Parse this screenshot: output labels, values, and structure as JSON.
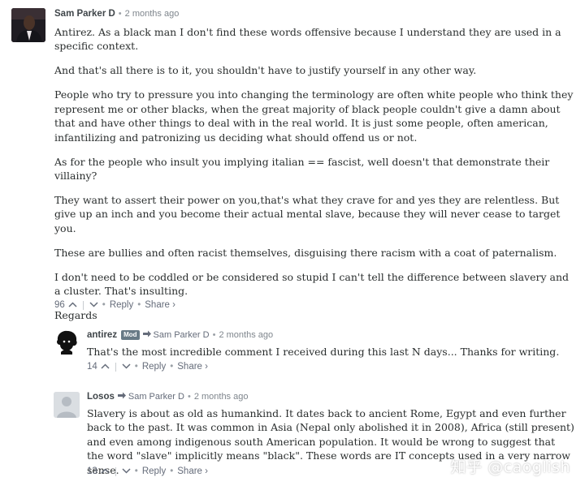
{
  "comments": [
    {
      "author": "Sam Parker D",
      "time": "2 months ago",
      "paragraphs": [
        "Antirez. As a black man I don't find these words offensive because I understand they are used in a specific context.",
        "And that's all there is to it, you shouldn't have to justify yourself in any other way.",
        "People who try to pressure you into changing the terminology are often white people who think they represent me or other blacks, when the great majority of black people couldn't give a damn about that and have other things to deal with in the real world. It is just some people, often american, infantilizing and patronizing us deciding what should offend us or not.",
        "As for the people who insult you implying italian == fascist, well doesn't that demonstrate their villainy?",
        "They want to assert their power on you,that's what they crave for and yes they are relentless. But give up an inch and you become their actual mental slave, because they will never cease to target you.",
        "These are bullies and often racist themselves, disguising there racism with a coat of paternalism.",
        "I don't need to be coddled or be considered so stupid I can't tell the difference between slavery and a cluster. That's insulting.",
        "Regards"
      ],
      "votes": "96",
      "reply_label": "Reply",
      "share_label": "Share ›"
    },
    {
      "author": "antirez",
      "badge": "Mod",
      "reply_to": "Sam Parker D",
      "time": "2 months ago",
      "paragraphs": [
        "That's the most incredible comment I received during this last N days... Thanks for writing."
      ],
      "votes": "14",
      "reply_label": "Reply",
      "share_label": "Share ›"
    },
    {
      "author": "Losos",
      "reply_to": "Sam Parker D",
      "time": "2 months ago",
      "paragraphs": [
        "Slavery is about as old as humankind. It dates back to ancient Rome, Egypt and even further back to the past. It was common in Asia (Nepal only abolished it in 2008), Africa (still present) and even among indigenous south American population. It would be wrong to suggest that the word \"slave\" implicitly means \"black\". These words are IT concepts used in a very narrow sense."
      ],
      "votes": "13",
      "reply_label": "Reply",
      "share_label": "Share ›"
    }
  ],
  "watermark": "知乎 @caoglish"
}
